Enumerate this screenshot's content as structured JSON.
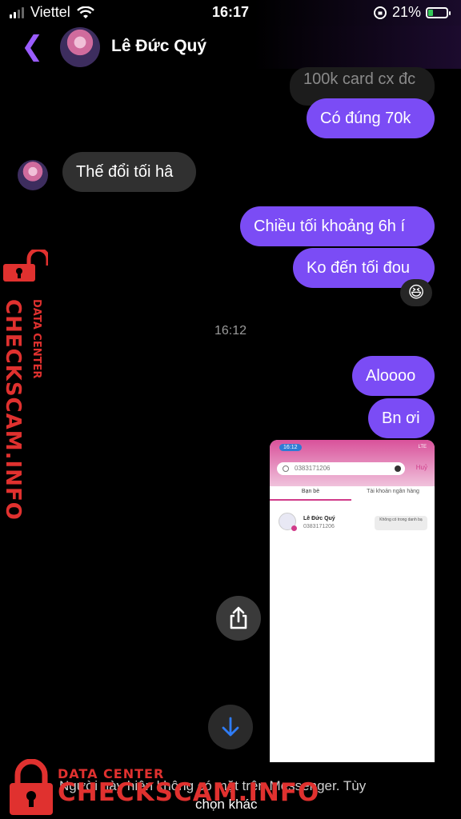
{
  "status_bar": {
    "carrier": "Viettel",
    "time": "16:17",
    "battery": "21%"
  },
  "header": {
    "contact_name": "Lê Đức Quý"
  },
  "messages": [
    {
      "side": "out",
      "text": "100k card cx đc"
    },
    {
      "side": "out",
      "text": "Có đúng 70k"
    },
    {
      "side": "in",
      "text": "Thế đổi tối hâ"
    },
    {
      "side": "out",
      "text": "Chiều tối khoảng 6h í"
    },
    {
      "side": "out",
      "text": "Ko đến tối đou",
      "reaction": "😆"
    },
    {
      "side": "out",
      "text": "Aloooo"
    },
    {
      "side": "out",
      "text": "Bn ơi"
    }
  ],
  "timestamp": "16:12",
  "shared_screenshot": {
    "time": "16:12",
    "signal": "LTE",
    "search_value": "0383171206",
    "cancel": "Huỷ",
    "tab_friends": "Bạn bè",
    "tab_bank": "Tài khoản ngân hàng",
    "result_name": "Lê Đức Quý",
    "result_phone": "0383171206",
    "result_chip": "Không có trong danh bạ"
  },
  "footer": {
    "info_text": "Người này hiện không có mặt trên Messenger. Tùy",
    "link_text": "chọn khác"
  },
  "watermark": {
    "small": "DATA CENTER",
    "big": "CHECKSCAM.INFO"
  },
  "colors": {
    "outgoing_bubble": "#7b4cf5",
    "incoming_bubble": "#303030",
    "accent": "#9a5cff",
    "watermark": "#e0312f"
  }
}
